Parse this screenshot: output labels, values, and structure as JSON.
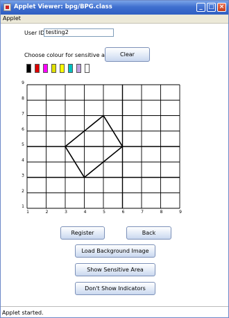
{
  "window": {
    "title": "Applet Viewer: bpg/BPG.class",
    "minimize": "_",
    "maximize": "□",
    "close": "×"
  },
  "menu": {
    "items": [
      "Applet"
    ]
  },
  "form": {
    "userid_label": "User ID:",
    "userid_value": "testing2",
    "colour_label": "Choose colour for sensitive area:",
    "clear_label": "Clear"
  },
  "palette": {
    "colors": [
      "#000000",
      "#e00000",
      "#ff00ff",
      "#e0e000",
      "#ffff00",
      "#00c0c0",
      "#c0a0e0",
      "#ffffff"
    ]
  },
  "grid": {
    "x_ticks": [
      "1",
      "2",
      "3",
      "4",
      "5",
      "6",
      "7",
      "8",
      "9"
    ],
    "y_ticks": [
      "1",
      "2",
      "3",
      "4",
      "5",
      "6",
      "7",
      "8",
      "9"
    ],
    "polygon": [
      [
        3,
        5
      ],
      [
        5,
        7
      ],
      [
        6,
        5
      ],
      [
        4,
        3
      ]
    ]
  },
  "buttons": {
    "register": "Register",
    "back": "Back",
    "load_bg": "Load Background Image",
    "show_sensitive": "Show Sensitive Area",
    "dont_show_indicators": "Don't Show Indicators"
  },
  "status": {
    "text": "Applet started."
  }
}
